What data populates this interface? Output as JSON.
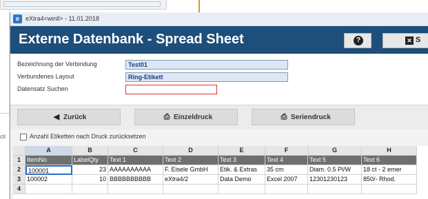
{
  "window": {
    "titlebar_text": "eXtra4<winll> - 11.01.2018",
    "app_icon_letter": "e",
    "title": "Externe Datenbank - Spread Sheet",
    "close_label": "S"
  },
  "background": {
    "edge_text": "cti"
  },
  "form": {
    "connection_label": "Bezeichnung der Verbindung",
    "connection_value": "Test01",
    "layout_label": "Verbundenes Layout",
    "layout_value": "Ring-Etikett",
    "search_label": "Datensatz Suchen",
    "search_value": ""
  },
  "toolbar": {
    "back_label": "Zurück",
    "single_print_label": "Einzeldruck",
    "serial_print_label": "Seriendruck"
  },
  "options": {
    "reset_label": "Anzahl Etiketten nach Druck zurücksetzen",
    "reset_checked": false
  },
  "grid": {
    "columns": [
      "A",
      "B",
      "C",
      "D",
      "E",
      "F",
      "G",
      "H"
    ],
    "active_column": "A",
    "rows": [
      {
        "row": "1",
        "cells": [
          "ItemNo",
          "LabelQty",
          "Text 1",
          "Text 2",
          "Text 3",
          "Text 4",
          "Text 5",
          "Text 6"
        ]
      },
      {
        "row": "2",
        "cells": [
          "100001",
          "23",
          "AAAAAAAAAA",
          "F. Eisele GmbH",
          "Etik. & Extras",
          "35 cm",
          "Diam. 0.5 Pl/W",
          "18 ct - 2 emer"
        ]
      },
      {
        "row": "3",
        "cells": [
          "100002",
          "10",
          "BBBBBBBBBB",
          "eXtra4/2",
          "Data Demo",
          "Excel 2007",
          "12301230123",
          "850/- Rhod."
        ]
      },
      {
        "row": "4",
        "cells": [
          "",
          "",
          "",
          "",
          "",
          "",
          "",
          ""
        ]
      }
    ]
  },
  "colors": {
    "header_bg": "#1e4e7a",
    "header_row_bg": "#6f6f6f",
    "input_bg": "#dce6f4",
    "search_border": "#e03030",
    "selection": "#2c6bc7"
  }
}
